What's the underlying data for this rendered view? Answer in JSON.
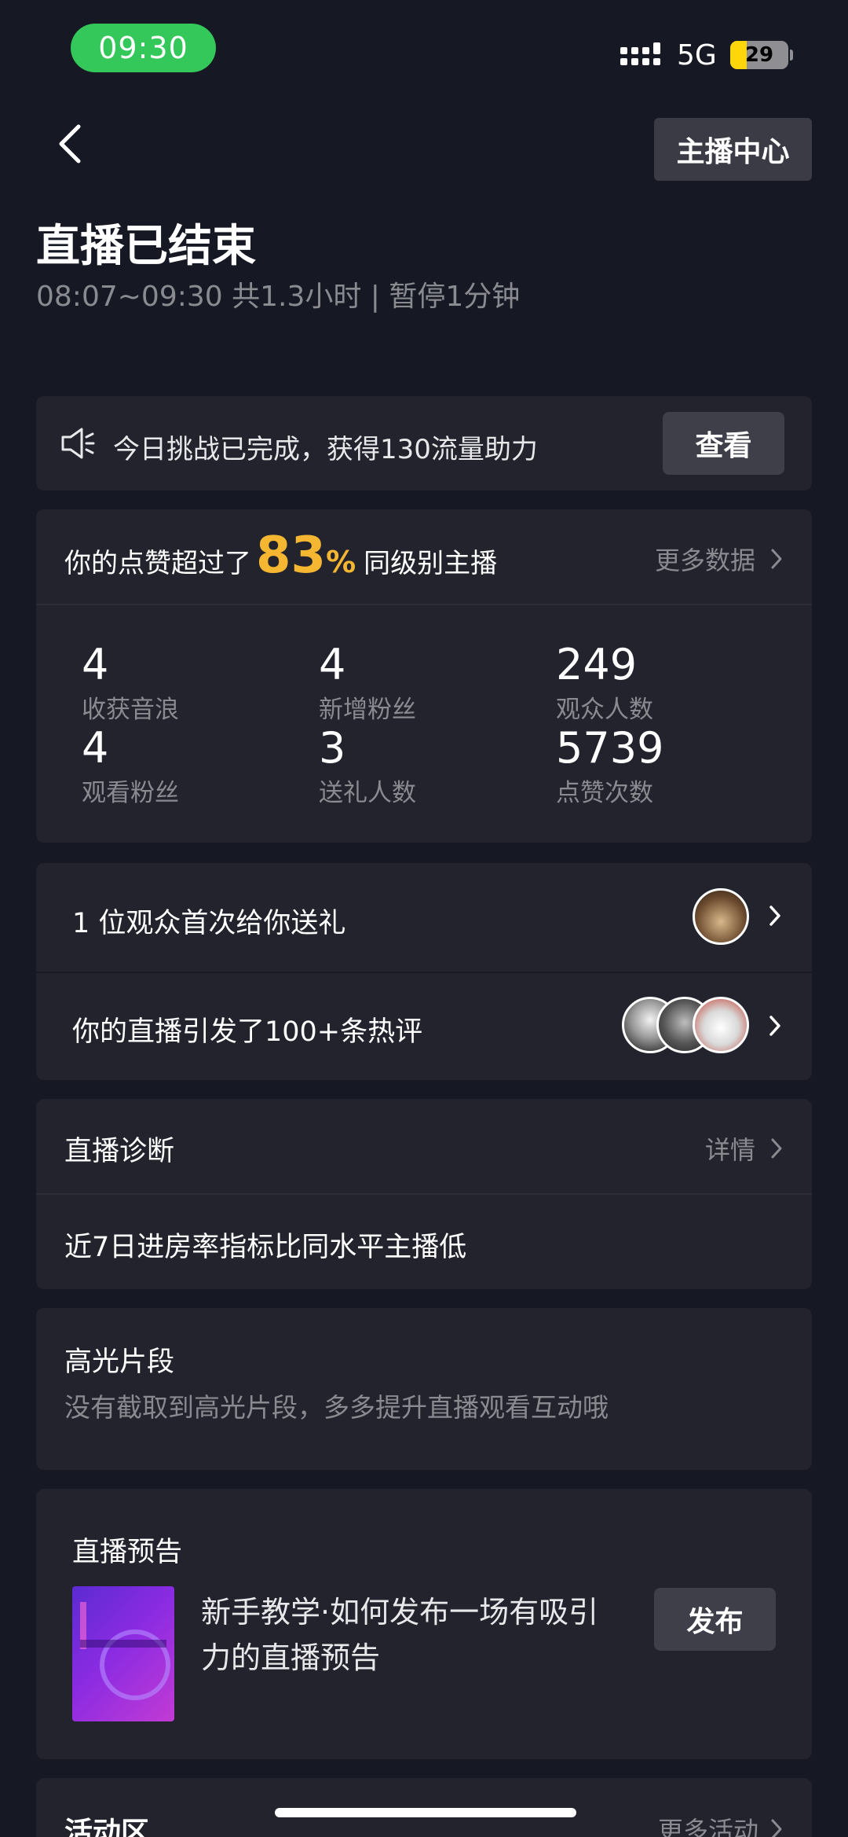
{
  "status_bar": {
    "time": "09:30",
    "network": "5G",
    "battery": "29",
    "battery_level": 0.29
  },
  "header": {
    "host_center_label": "主播中心"
  },
  "title": "直播已结束",
  "subtitle": "08:07~09:30 共1.3小时 | 暂停1分钟",
  "challenge": {
    "text": "今日挑战已完成，获得130流量助力",
    "button": "查看"
  },
  "stats": {
    "likes_prefix": "你的点赞超过了",
    "likes_percent": "83",
    "likes_percent_sign": "%",
    "likes_suffix": "同级别主播",
    "more_data": "更多数据",
    "items": [
      {
        "value": "4",
        "label": "收获音浪"
      },
      {
        "value": "4",
        "label": "新增粉丝"
      },
      {
        "value": "249",
        "label": "观众人数"
      },
      {
        "value": "4",
        "label": "观看粉丝"
      },
      {
        "value": "3",
        "label": "送礼人数"
      },
      {
        "value": "5739",
        "label": "点赞次数"
      }
    ]
  },
  "notifications": {
    "gift": "1 位观众首次给你送礼",
    "comments": "你的直播引发了100+条热评"
  },
  "diagnosis": {
    "title": "直播诊断",
    "detail": "详情",
    "text": "近7日进房率指标比同水平主播低"
  },
  "highlight": {
    "title": "高光片段",
    "desc": "没有截取到高光片段，多多提升直播观看互动哦"
  },
  "preview": {
    "title": "直播预告",
    "text": "新手教学·如何发布一场有吸引力的直播预告",
    "button": "发布"
  },
  "activity": {
    "title": "活动区",
    "more": "更多活动"
  },
  "colors": {
    "background": "#161823",
    "card": "#22232d",
    "accent": "#f5b731",
    "status_green": "#34c759"
  }
}
